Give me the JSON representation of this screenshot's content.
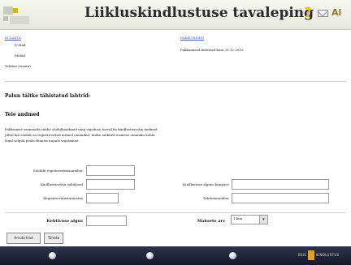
{
  "header": {
    "title": "Liikluskindlustuse tavaleping",
    "help_label": "?",
    "lang_label": "Al"
  },
  "left_panel": {
    "heading": "KÜLASTA",
    "lines": [
      "E-Mail",
      "Mobiil",
      "Telefon (tasuta)"
    ]
  },
  "right_panel": {
    "heading": "PAKKUMISED",
    "line": "Pakkumised kehtivad kuni 31.12.2019"
  },
  "main": {
    "heading": "Palun täitke tähistatud lahtrid:",
    "subheading": "Teie andmed",
    "instructions": [
      "Pakkumise saamiseks täitke sõidukiandmed ning vajaduse korral ka kindlustusvõtja andmed",
      "Juhul kui sõiduk on registreeritud mitmel omanikul, täitke andmed esimese omaniku kohta",
      "Hind selgub peale Kinnita nupule vajutamist"
    ]
  },
  "form": {
    "fields": [
      {
        "label": "Sõiduki registreerimisnumber",
        "value": ""
      },
      {
        "label": "Kindlustusvõtja isikukood",
        "value": ""
      },
      {
        "label": "Kindlustuse alguse kuupäev",
        "value": ""
      },
      {
        "label": "Registreerimistunnistus",
        "value": ""
      },
      {
        "label": "Telefoninumber",
        "value": ""
      }
    ],
    "period_label": "Kehtivuse algus",
    "period_value": "",
    "payment_label": "Maksete arv",
    "payment_value": "1 kuu",
    "submit_label": "Arvuta hind",
    "cancel_label": "Tühista"
  },
  "footer": {
    "logo_left": "BSIS",
    "logo_right": "KINDLUSTUS"
  }
}
